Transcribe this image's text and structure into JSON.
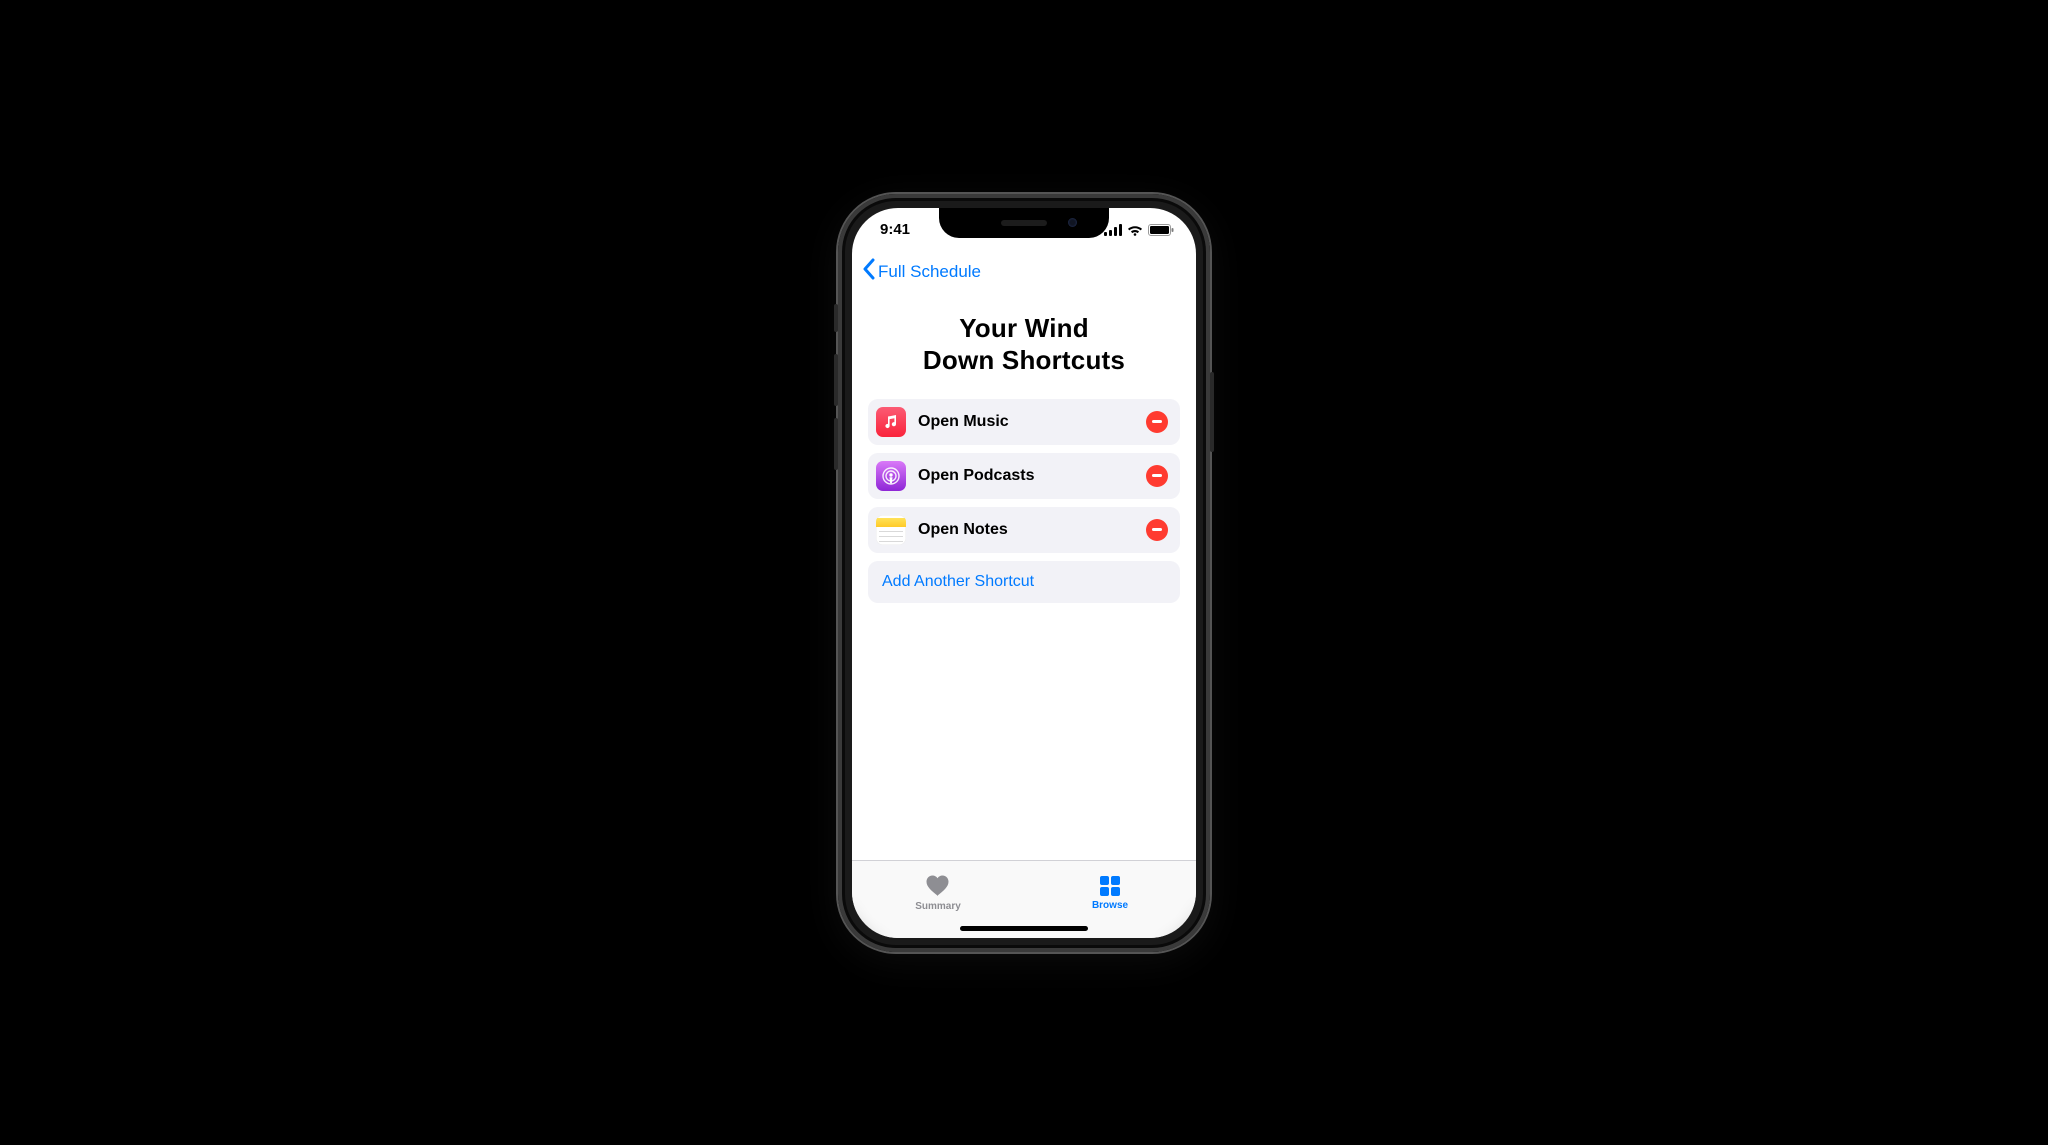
{
  "status": {
    "time": "9:41"
  },
  "nav": {
    "back_label": "Full Schedule"
  },
  "title_line_1": "Your Wind",
  "title_line_2": "Down Shortcuts",
  "shortcuts": {
    "music": {
      "label": "Open Music"
    },
    "podcasts": {
      "label": "Open Podcasts"
    },
    "notes": {
      "label": "Open Notes"
    }
  },
  "add_label": "Add Another Shortcut",
  "tabs": {
    "summary": "Summary",
    "browse": "Browse"
  }
}
